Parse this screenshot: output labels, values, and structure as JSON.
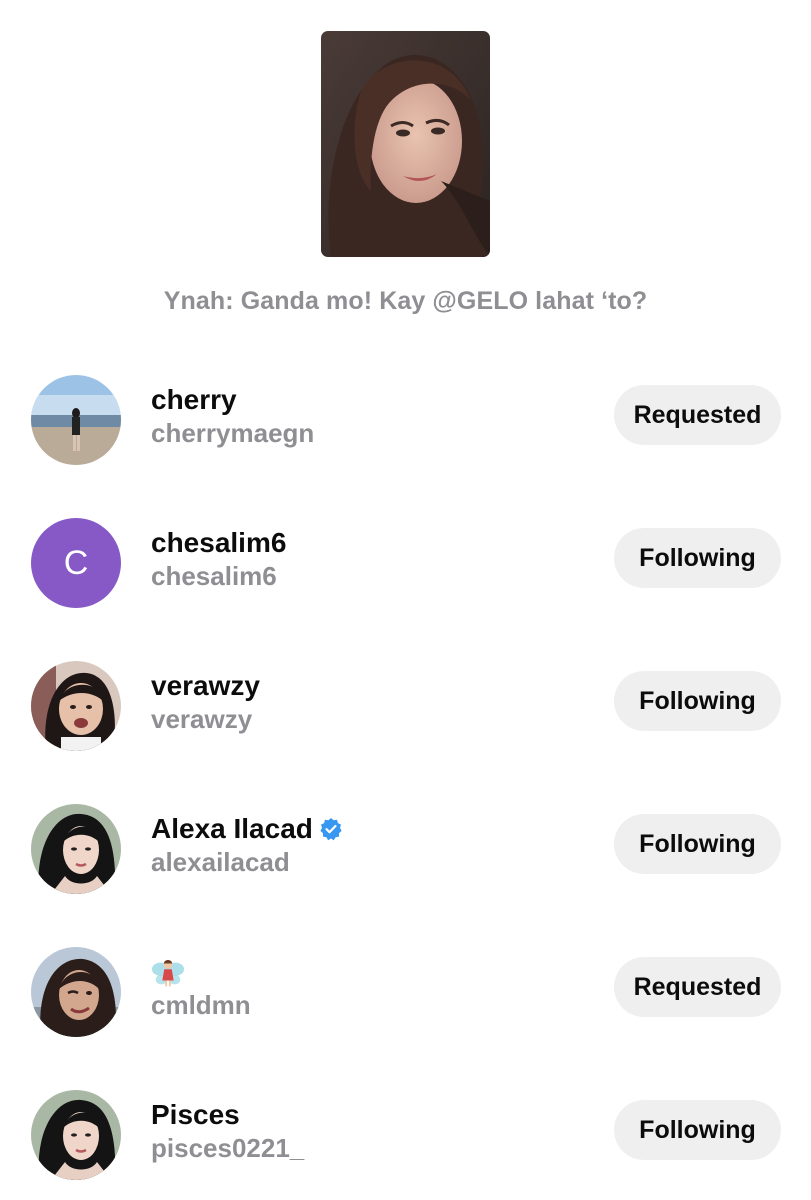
{
  "post": {
    "image_icon": "portrait-photo",
    "caption": "Ynah: Ganda mo! Kay @GELO lahat ‘to?"
  },
  "users": [
    {
      "name": "cherry",
      "username": "cherrymaegn",
      "button": "Requested",
      "avatar": "beach-photo"
    },
    {
      "name": "chesalim6",
      "username": "chesalim6",
      "button": "Following",
      "avatar": "letter",
      "avatar_letter": "C",
      "avatar_color": "#8659c6"
    },
    {
      "name": "verawzy",
      "username": "verawzy",
      "button": "Following",
      "avatar": "selfie-photo"
    },
    {
      "name": "Alexa Ilacad",
      "username": "alexailacad",
      "button": "Following",
      "avatar": "portrait-photo",
      "verified": true,
      "verified_color": "#3897f0"
    },
    {
      "name": "🧚",
      "username": "cmldmn",
      "button": "Requested",
      "avatar": "selfie-photo"
    },
    {
      "name": "Pisces",
      "username": "pisces0221_",
      "button": "Following",
      "avatar": "portrait-photo"
    }
  ]
}
